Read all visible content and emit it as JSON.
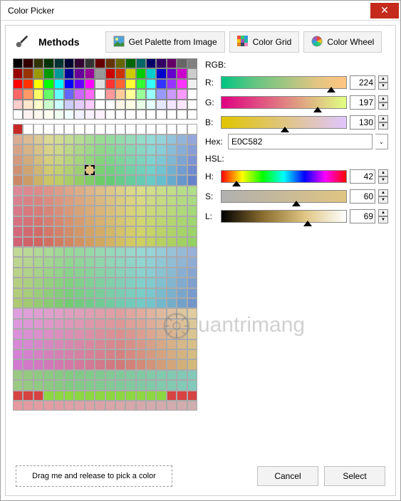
{
  "title": "Color Picker",
  "toolbar": {
    "methods_label": "Methods",
    "palette_btn": "Get Palette from Image",
    "grid_btn": "Color Grid",
    "wheel_btn": "Color Wheel"
  },
  "labels": {
    "rgb": "RGB:",
    "r": "R:",
    "g": "G:",
    "b": "B:",
    "hex": "Hex:",
    "hsl": "HSL:",
    "h": "H:",
    "s": "S:",
    "l": "L:"
  },
  "values": {
    "r": "224",
    "g": "197",
    "b": "130",
    "hex": "E0C582",
    "h": "42",
    "s": "60",
    "l": "69"
  },
  "positions": {
    "r": 88,
    "g": 77,
    "b": 51,
    "h": 12,
    "s": 60,
    "l": 69
  },
  "footer": {
    "drag": "Drag me and release to pick a color",
    "cancel": "Cancel",
    "select": "Select"
  },
  "watermark": "uantrimang",
  "basic_palette": [
    "#000000",
    "#330000",
    "#333300",
    "#003300",
    "#003333",
    "#000033",
    "#330033",
    "#333333",
    "#660000",
    "#663300",
    "#666600",
    "#006600",
    "#006666",
    "#000066",
    "#330066",
    "#660066",
    "#666666",
    "#808080",
    "#990000",
    "#993300",
    "#999900",
    "#009900",
    "#009999",
    "#000099",
    "#660099",
    "#990099",
    "#999999",
    "#CC0000",
    "#CC3300",
    "#CCCC00",
    "#00CC00",
    "#00CCCC",
    "#0000CC",
    "#6600CC",
    "#CC00CC",
    "#CCCCCC",
    "#FF0000",
    "#FF3300",
    "#FFFF00",
    "#00FF00",
    "#00FFFF",
    "#0000FF",
    "#6600FF",
    "#FF00FF",
    "#E0E0E0",
    "#FF3333",
    "#FF6633",
    "#FFFF33",
    "#33FF33",
    "#33FFFF",
    "#3333FF",
    "#9933FF",
    "#FF33FF",
    "#F0F0F0",
    "#FF6666",
    "#FF9966",
    "#FFFF66",
    "#66FF66",
    "#66FFFF",
    "#6666FF",
    "#CC66FF",
    "#FF66FF",
    "#FAFAFA",
    "#FF9999",
    "#FFCC99",
    "#FFFF99",
    "#99FF99",
    "#99FFFF",
    "#9999FF",
    "#CC99FF",
    "#FF99FF",
    "#FFFFFF",
    "#FFCCCC",
    "#FFE5CC",
    "#FFFFCC",
    "#CCFFCC",
    "#CCFFFF",
    "#CCCCFF",
    "#E5CCFF",
    "#FFCCFF",
    "#FFFFFF",
    "#FFFFFF",
    "#FFF5E6",
    "#FFFEE6",
    "#E6FFE6",
    "#E6FFFF",
    "#E6E6FF",
    "#F5E6FF",
    "#FFE6FF",
    "#FFFFFF",
    "#FFFFFF",
    "#FFF0F0",
    "#FFF8F0",
    "#FFFFF0",
    "#F0FFF0",
    "#F0FFFF",
    "#F0F0FF",
    "#F8F0FF",
    "#FFF0FF",
    "#FFFFFF",
    "#FFFFFF",
    "#FFFFFF",
    "#FFFFFF",
    "#FFFFFF",
    "#FFFFFF",
    "#FFFFFF",
    "#FFFFFF",
    "#FFFFFF"
  ]
}
